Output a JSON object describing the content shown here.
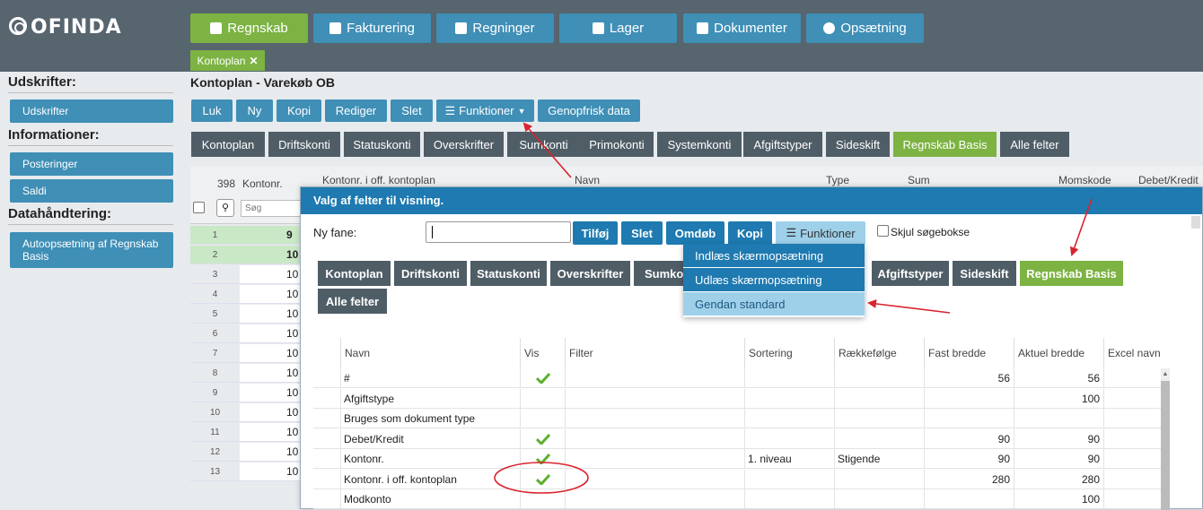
{
  "logo": {
    "text": "OFINDA"
  },
  "nav": [
    {
      "label": "Regnskab",
      "active": true
    },
    {
      "label": "Fakturering"
    },
    {
      "label": "Regninger"
    },
    {
      "label": "Lager"
    },
    {
      "label": "Dokumenter"
    },
    {
      "label": "Opsætning"
    }
  ],
  "open_tab": {
    "label": "Kontoplan",
    "close": "✕"
  },
  "sidebar": {
    "sections": [
      {
        "heading": "Udskrifter:",
        "buttons": [
          "Udskrifter"
        ]
      },
      {
        "heading": "Informationer:",
        "buttons": [
          "Posteringer",
          "Saldi"
        ]
      },
      {
        "heading": "Datahåndtering:",
        "buttons": [
          "Autoopsætning af Regnskab Basis"
        ]
      }
    ]
  },
  "main": {
    "title": "Kontoplan - Varekøb OB",
    "toolbar": [
      "Luk",
      "Ny",
      "Kopi",
      "Rediger",
      "Slet",
      "Funktioner",
      "Genopfrisk data"
    ],
    "view_tabs": [
      "Kontoplan",
      "Driftskonti",
      "Statuskonti",
      "Overskrifter",
      "Sumkonti",
      "Primokonti",
      "Systemkonti",
      "Afgiftstyper",
      "Sideskift",
      "Regnskab Basis",
      "Alle felter"
    ],
    "grid": {
      "count": "398",
      "col_kontonr": "Kontonr.",
      "search_placeholder": "Søg",
      "headers": [
        "Kontonr. i off. kontoplan",
        "Navn",
        "Type",
        "Sum",
        "Momskode",
        "Debet/Kredit"
      ],
      "row_numbers": [
        "1",
        "2",
        "3",
        "4",
        "5",
        "6",
        "7",
        "8",
        "9",
        "10",
        "11",
        "12",
        "13"
      ],
      "row_values": [
        "9",
        "10",
        "10",
        "10",
        "10",
        "10",
        "10",
        "10",
        "10",
        "10",
        "10",
        "10",
        "10"
      ]
    }
  },
  "modal": {
    "title": "Valg af felter til visning.",
    "new_tab_label": "Ny fane:",
    "buttons": [
      "Tilføj",
      "Slet",
      "Omdøb",
      "Kopi",
      "Funktioner"
    ],
    "hide_search_label": "Skjul søgebokse",
    "tabs": [
      "Kontoplan",
      "Driftskonti",
      "Statuskonti",
      "Overskrifter",
      "Sumkonti",
      "Afgiftstyper",
      "Sideskift",
      "Regnskab Basis",
      "Alle felter"
    ],
    "dropdown": [
      "Indlæs skærmopsætning",
      "Udlæs skærmopsætning",
      "Gendan standard"
    ],
    "columns": [
      "Navn",
      "Vis",
      "Filter",
      "Sortering",
      "Rækkefølge",
      "Fast bredde",
      "Aktuel bredde",
      "Excel navn"
    ],
    "rows": [
      {
        "navn": "#",
        "vis": true,
        "sortering": "",
        "raekke": "",
        "fast": "56",
        "aktuel": "56"
      },
      {
        "navn": "Afgiftstype",
        "vis": false,
        "sortering": "",
        "raekke": "",
        "fast": "",
        "aktuel": "100"
      },
      {
        "navn": "Bruges som dokument type",
        "vis": false,
        "sortering": "",
        "raekke": "",
        "fast": "",
        "aktuel": ""
      },
      {
        "navn": "Debet/Kredit",
        "vis": true,
        "sortering": "",
        "raekke": "",
        "fast": "90",
        "aktuel": "90"
      },
      {
        "navn": "Kontonr.",
        "vis": true,
        "sortering": "1. niveau",
        "raekke": "Stigende",
        "fast": "90",
        "aktuel": "90"
      },
      {
        "navn": "Kontonr. i off. kontoplan",
        "vis": true,
        "sortering": "",
        "raekke": "",
        "fast": "280",
        "aktuel": "280"
      },
      {
        "navn": "Modkonto",
        "vis": false,
        "sortering": "",
        "raekke": "",
        "fast": "",
        "aktuel": "100"
      }
    ]
  },
  "colors": {
    "topbar": "#57656f",
    "blue": "#3f8fb6",
    "green": "#7cb342",
    "dark_tab": "#4f5d67",
    "modal_blue": "#1e7ab0",
    "annotation_red": "#d9232e"
  }
}
